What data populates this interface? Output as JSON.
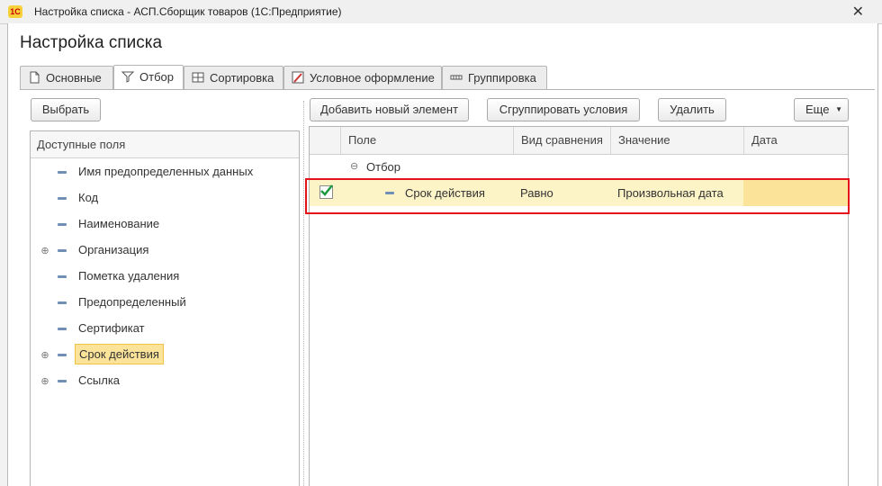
{
  "window": {
    "title": "Настройка списка - АСП.Сборщик товаров  (1С:Предприятие)",
    "logo_text": "1С",
    "close_glyph": "✕"
  },
  "form": {
    "title": "Настройка списка"
  },
  "tabs": [
    {
      "label": "Основные",
      "icon": "document-icon",
      "active": false
    },
    {
      "label": "Отбор",
      "icon": "filter-icon",
      "active": true
    },
    {
      "label": "Сортировка",
      "icon": "sort-icon",
      "active": false
    },
    {
      "label": "Условное оформление",
      "icon": "conditional-format-icon",
      "active": false
    },
    {
      "label": "Группировка",
      "icon": "grouping-icon",
      "active": false
    }
  ],
  "left": {
    "select_button": "Выбрать",
    "header": "Доступные поля",
    "fields": [
      {
        "label": "Имя предопределенных данных",
        "expandable": false,
        "selected": false
      },
      {
        "label": "Код",
        "expandable": false,
        "selected": false
      },
      {
        "label": "Наименование",
        "expandable": false,
        "selected": false
      },
      {
        "label": "Организация",
        "expandable": true,
        "selected": false
      },
      {
        "label": "Пометка удаления",
        "expandable": false,
        "selected": false
      },
      {
        "label": "Предопределенный",
        "expandable": false,
        "selected": false
      },
      {
        "label": "Сертификат",
        "expandable": false,
        "selected": false
      },
      {
        "label": "Срок действия",
        "expandable": true,
        "selected": true
      },
      {
        "label": "Ссылка",
        "expandable": true,
        "selected": false
      }
    ]
  },
  "right": {
    "toolbar": {
      "add": "Добавить новый элемент",
      "group": "Сгруппировать условия",
      "delete": "Удалить",
      "more": "Еще"
    },
    "columns": [
      "Поле",
      "Вид сравнения",
      "Значение",
      "Дата"
    ],
    "group_row": {
      "label": "Отбор"
    },
    "condition_row": {
      "checked": true,
      "field": "Срок действия",
      "comparison": "Равно",
      "value": "Произвольная дата",
      "date": ""
    }
  },
  "colors": {
    "selection": "#fbe49a",
    "row_highlight": "#fcf3c6",
    "annotation_box": "#e3121b",
    "check": "#1c9a3e"
  }
}
